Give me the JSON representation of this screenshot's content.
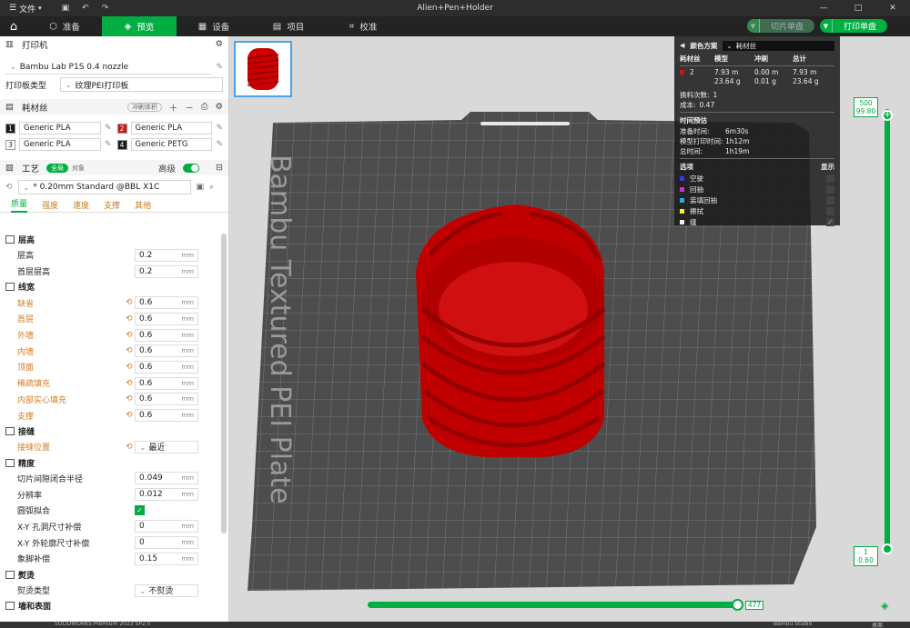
{
  "titlebar": {
    "menu_label": "文件",
    "title": "Alien+Pen+Holder"
  },
  "toolbar": {
    "tabs": [
      {
        "label": "准备"
      },
      {
        "label": "预览"
      },
      {
        "label": "设备"
      },
      {
        "label": "项目"
      },
      {
        "label": "校准"
      }
    ],
    "slice_label": "切片单盘",
    "print_label": "打印单盘"
  },
  "printer": {
    "section": "打印机",
    "model": "Bambu Lab P1S 0.4 nozzle",
    "plate_type_label": "打印板类型",
    "plate_type_value": "纹理PEI打印板"
  },
  "filament": {
    "section": "耗材丝",
    "flush_label": "冲刷体积",
    "items": [
      {
        "num": "1",
        "name": "Generic PLA",
        "color": "#1a1a1a"
      },
      {
        "num": "2",
        "name": "Generic PLA",
        "color": "#d31212"
      },
      {
        "num": "3",
        "name": "Generic PLA",
        "color": "#ffffff"
      },
      {
        "num": "4",
        "name": "Generic PETG",
        "color": "#1a1a1a"
      }
    ]
  },
  "process": {
    "section": "工艺",
    "global_label": "全局",
    "object_label": "对象",
    "advanced_label": "高级",
    "preset": "* 0.20mm Standard @BBL X1C",
    "tabs": [
      "质量",
      "强度",
      "速度",
      "支撑",
      "其他"
    ]
  },
  "settings": {
    "layer_height": {
      "group": "层高",
      "rows": [
        {
          "label": "层高",
          "value": "0.2",
          "unit": "mm"
        },
        {
          "label": "首层层高",
          "value": "0.2",
          "unit": "mm"
        }
      ]
    },
    "line_width": {
      "group": "线宽",
      "rows": [
        {
          "label": "缺省",
          "value": "0.6",
          "unit": "mm"
        },
        {
          "label": "首层",
          "value": "0.6",
          "unit": "mm"
        },
        {
          "label": "外墙",
          "value": "0.6",
          "unit": "mm"
        },
        {
          "label": "内墙",
          "value": "0.6",
          "unit": "mm"
        },
        {
          "label": "顶面",
          "value": "0.6",
          "unit": "mm"
        },
        {
          "label": "稀疏填充",
          "value": "0.6",
          "unit": "mm"
        },
        {
          "label": "内部实心填充",
          "value": "0.6",
          "unit": "mm"
        },
        {
          "label": "支撑",
          "value": "0.6",
          "unit": "mm"
        }
      ]
    },
    "seam": {
      "group": "接缝",
      "rows": [
        {
          "label": "接缝位置",
          "value": "最近"
        }
      ]
    },
    "precision": {
      "group": "精度",
      "rows": [
        {
          "label": "切片间隙闭合半径",
          "value": "0.049",
          "unit": "mm"
        },
        {
          "label": "分辨率",
          "value": "0.012",
          "unit": "mm"
        },
        {
          "label": "圆弧拟合",
          "value": "✓"
        },
        {
          "label": "X-Y 孔洞尺寸补偿",
          "value": "0",
          "unit": "mm"
        },
        {
          "label": "X-Y 外轮廓尺寸补偿",
          "value": "0",
          "unit": "mm"
        },
        {
          "label": "象脚补偿",
          "value": "0.15",
          "unit": "mm"
        }
      ]
    },
    "ironing": {
      "group": "熨烫",
      "rows": [
        {
          "label": "熨烫类型",
          "value": "不熨烫"
        }
      ]
    },
    "wall_group": "墙和表面"
  },
  "plate": {
    "text": "Bambu Textured PEI Plate"
  },
  "legend": {
    "scheme_label": "颜色方案",
    "scheme_value": "耗材丝",
    "cols": [
      "耗材丝",
      "模型",
      "冲刷",
      "总计"
    ],
    "row": {
      "id": "2",
      "model_m": "7.93 m",
      "model_g": "23.64 g",
      "flush_m": "0.00 m",
      "flush_g": "0.01 g",
      "total_m": "7.93 m",
      "total_g": "23.64 g"
    },
    "changes_label": "换料次数:",
    "changes_value": "1",
    "cost_label": "成本:",
    "cost_value": "0.47",
    "time_section": "时间预估",
    "prep_label": "准备时间:",
    "prep_value": "6m30s",
    "model_time_label": "模型打印时间:",
    "model_time_value": "1h12m",
    "total_time_label": "总时间:",
    "total_time_value": "1h19m",
    "options_label": "选项",
    "display_label": "显示",
    "options": [
      {
        "label": "空驶",
        "color": "#3a3ad8"
      },
      {
        "label": "回抽",
        "color": "#cc33cc"
      },
      {
        "label": "装填回抽",
        "color": "#33aadd"
      },
      {
        "label": "擦拭",
        "color": "#ffee22"
      },
      {
        "label": "缝",
        "color": "#eeeeee"
      }
    ]
  },
  "sliders": {
    "top_layer": "500",
    "top_height": "99.80",
    "bottom_layer": "1",
    "bottom_height": "0.60",
    "move": "477"
  },
  "taskbar": {
    "item1": "SOLIDWORKS Premium 2023 SP2.0",
    "item2": "Bambu Studio",
    "item3": "桌面"
  }
}
